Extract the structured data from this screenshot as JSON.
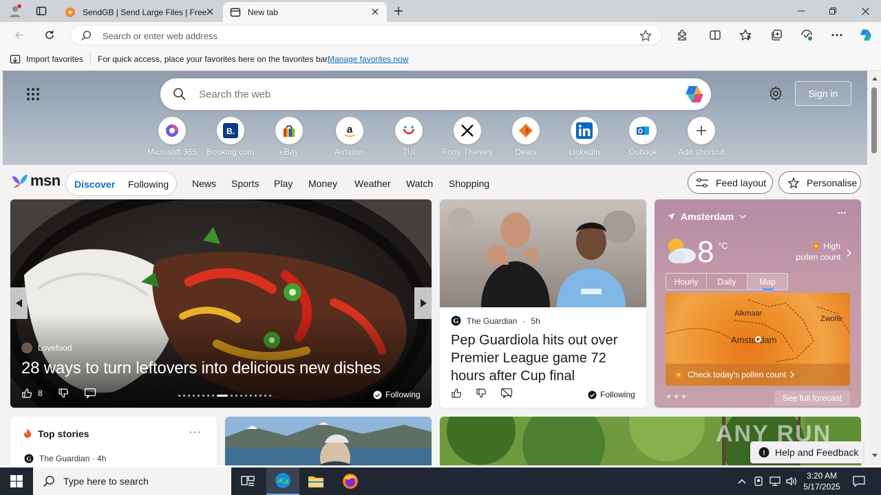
{
  "browser": {
    "tabs": [
      {
        "title": "SendGB | Send Large Files | Free f"
      },
      {
        "title": "New tab"
      }
    ],
    "address_placeholder": "Search or enter web address"
  },
  "favorites_bar": {
    "import_label": "Import favorites",
    "message": "For quick access, place your favorites here on the favorites bar.",
    "link": "Manage favorites now"
  },
  "hero": {
    "search_placeholder": "Search the web",
    "sign_in": "Sign in",
    "shortcuts": [
      {
        "label": "Microsoft 365"
      },
      {
        "label": "Booking.com"
      },
      {
        "label": "eBay"
      },
      {
        "label": "Amazon"
      },
      {
        "label": "TUI"
      },
      {
        "label": "Forty Thieves"
      },
      {
        "label": "Deals"
      },
      {
        "label": "LinkedIn"
      },
      {
        "label": "Outlook"
      },
      {
        "label": "Add shortcut"
      }
    ]
  },
  "msn": {
    "logo": "msn",
    "discover": "Discover",
    "following": "Following",
    "nav": [
      "News",
      "Sports",
      "Play",
      "Money",
      "Weather",
      "Watch",
      "Shopping"
    ],
    "feed_layout": "Feed layout",
    "personalise": "Personalise"
  },
  "feature": {
    "source": "Lovefood",
    "headline": "28 ways to turn leftovers into delicious new dishes",
    "likes": "8",
    "following": "Following"
  },
  "story2": {
    "source": "The Guardian",
    "age": "5h",
    "headline": "Pep Guardiola hits out over Premier League game 72 hours after Cup final",
    "following": "Following"
  },
  "weather": {
    "city": "Amsterdam",
    "temp": "8",
    "unit": "°C",
    "pollen_line1": "High",
    "pollen_line2": "pollen count",
    "tabs": [
      "Hourly",
      "Daily",
      "Map"
    ],
    "active_tab": "Map",
    "map_places": [
      "Alkmaar",
      "Zwolle",
      "Amsterdam"
    ],
    "pollen_cta": "Check today's pollen count",
    "forecast": "See full forecast"
  },
  "top_stories": {
    "title": "Top stories",
    "source": "The Guardian · 4h"
  },
  "help": "Help and Feedback",
  "watermark": "ANY RUN",
  "taskbar": {
    "search_placeholder": "Type here to search",
    "time": "3:20 AM",
    "date": "5/17/2025"
  }
}
